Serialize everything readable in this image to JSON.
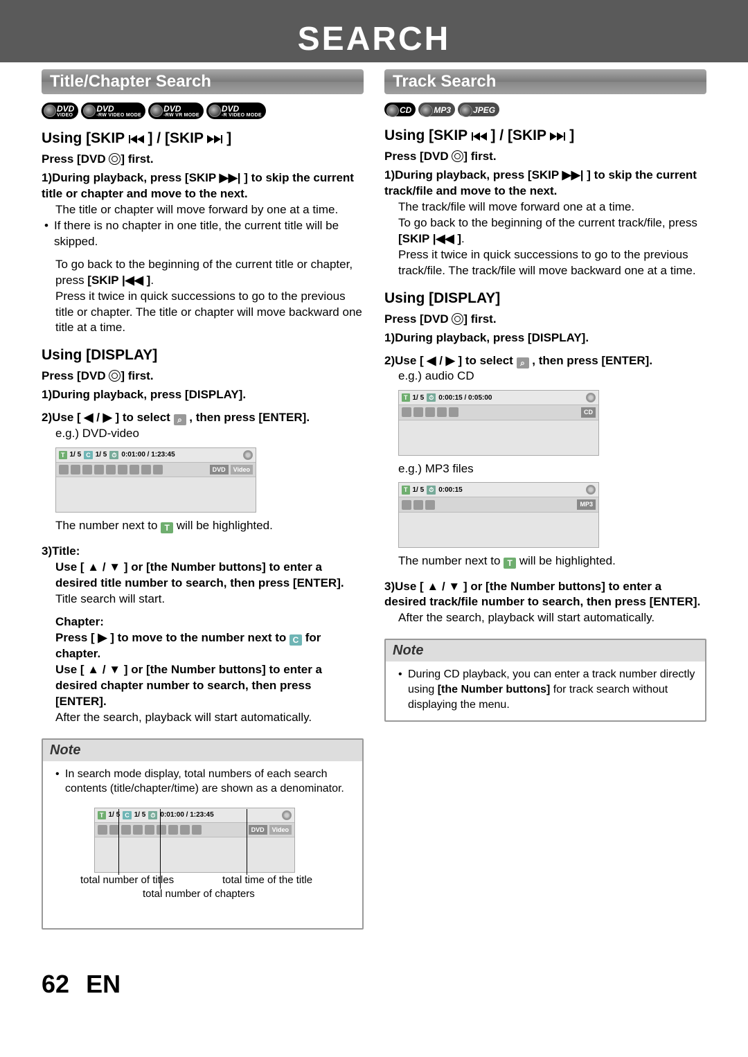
{
  "header": {
    "title": "SEARCH"
  },
  "left": {
    "section_title": "Title/Chapter Search",
    "discs": [
      {
        "top": "DVD",
        "bot": "VIDEO"
      },
      {
        "top": "DVD",
        "bot": "-RW VIDEO MODE"
      },
      {
        "top": "DVD",
        "bot": "-RW VR MODE"
      },
      {
        "top": "DVD",
        "bot": "-R VIDEO MODE"
      }
    ],
    "sub1": "Using [SKIP |◀◀ ] / [SKIP ▶▶| ]",
    "press_first": "Press [DVD ⊚] first.",
    "s1_head": "1)During playback, press [SKIP ▶▶| ] to skip the current title or chapter and move to the next.",
    "s1_line1": "The title or chapter will move forward by one at a time.",
    "s1_bullet": "If there is no chapter in one title, the current title will be skipped.",
    "s1_para2a": "To go back to the beginning of the current title or chapter, press ",
    "s1_para2b": "[SKIP |◀◀ ]",
    "s1_para2c": ".",
    "s1_para3": "Press it twice in quick successions to go to the previous title or chapter. The title or chapter will move backward one title at a time.",
    "sub2": "Using [DISPLAY]",
    "s2_step1": "1)During playback, press [DISPLAY].",
    "s2_step2a": "2)Use [ ◀ / ▶ ] to select ",
    "s2_step2b": " , then press [ENTER].",
    "s2_eg": "e.g.) DVD-video",
    "osd1": {
      "T": "T",
      "t": "1/  5",
      "C": "C",
      "c": "1/  5",
      "time": "0:01:00 / 1:23:45",
      "media1": "DVD",
      "media2": "Video"
    },
    "s2_after_osd_a": "The number next to ",
    "s2_after_osd_b": " will be highlighted.",
    "s3_title": "3)Title:",
    "s3_title_body1": "Use [ ▲ / ▼ ] or [the Number buttons] to enter a desired title number to search, then press [ENTER].",
    "s3_title_body2": "Title search will start.",
    "s3_chapter": "Chapter:",
    "s3_ch_body1a": "Press [ ▶ ] to move to the number next to ",
    "s3_ch_body1b": " for chapter.",
    "s3_ch_body2": "Use [ ▲ / ▼ ] or [the Number buttons] to enter a desired chapter number to search, then press [ENTER].",
    "s3_ch_body3": "After the search, playback will start automatically.",
    "note_title": "Note",
    "note_bullet": "In search mode display, total numbers of each search contents (title/chapter/time) are shown as a denominator.",
    "callout_titles": "total number of titles",
    "callout_chapters": "total number of chapters",
    "callout_time": "total time of the title",
    "osd2": {
      "T": "T",
      "t": "1/  5",
      "C": "C",
      "c": "1/  5",
      "time": "0:01:00 / 1:23:45",
      "media1": "DVD",
      "media2": "Video"
    }
  },
  "right": {
    "section_title": "Track Search",
    "discs": [
      {
        "top": "CD",
        "bot": ""
      },
      {
        "top": "MP3",
        "bot": ""
      },
      {
        "top": "JPEG",
        "bot": ""
      }
    ],
    "sub1": "Using [SKIP |◀◀ ] / [SKIP ▶▶| ]",
    "press_first": "Press [DVD ⊚] first.",
    "s1_head": "1)During playback, press [SKIP ▶▶| ] to skip the current track/file and move to the next.",
    "s1_line1": "The track/file will move forward one at a time.",
    "s1_para2a": "To go back to the beginning of the current track/file, press ",
    "s1_para2b": "[SKIP |◀◀ ]",
    "s1_para2c": ".",
    "s1_para3": "Press it twice in quick successions to go to the previous track/file. The track/file will move backward one at a time.",
    "sub2": "Using [DISPLAY]",
    "s2_step1": "1)During playback, press [DISPLAY].",
    "s2_step2a": "2)Use [ ◀ / ▶ ] to select ",
    "s2_step2b": " , then press [ENTER].",
    "s2_eg1": "e.g.) audio CD",
    "osd1": {
      "T": "T",
      "t": "1/  5",
      "time": "0:00:15 / 0:05:00",
      "media": "CD"
    },
    "s2_eg2": "e.g.) MP3 files",
    "osd2": {
      "T": "T",
      "t": "1/  5",
      "time": "0:00:15",
      "media": "MP3"
    },
    "s2_after_osd_a": "The number next to ",
    "s2_after_osd_b": " will be highlighted.",
    "s3_head": "3)Use [ ▲ / ▼ ] or [the Number buttons] to enter a desired track/file number to search, then press [ENTER].",
    "s3_body": "After the search, playback will start automatically.",
    "note_title": "Note",
    "note_bullet_a": "During CD playback, you can enter a track number directly using ",
    "note_bullet_b": "[the Number buttons]",
    "note_bullet_c": " for track search without displaying the menu."
  },
  "footer": {
    "page": "62",
    "lang": "EN"
  }
}
